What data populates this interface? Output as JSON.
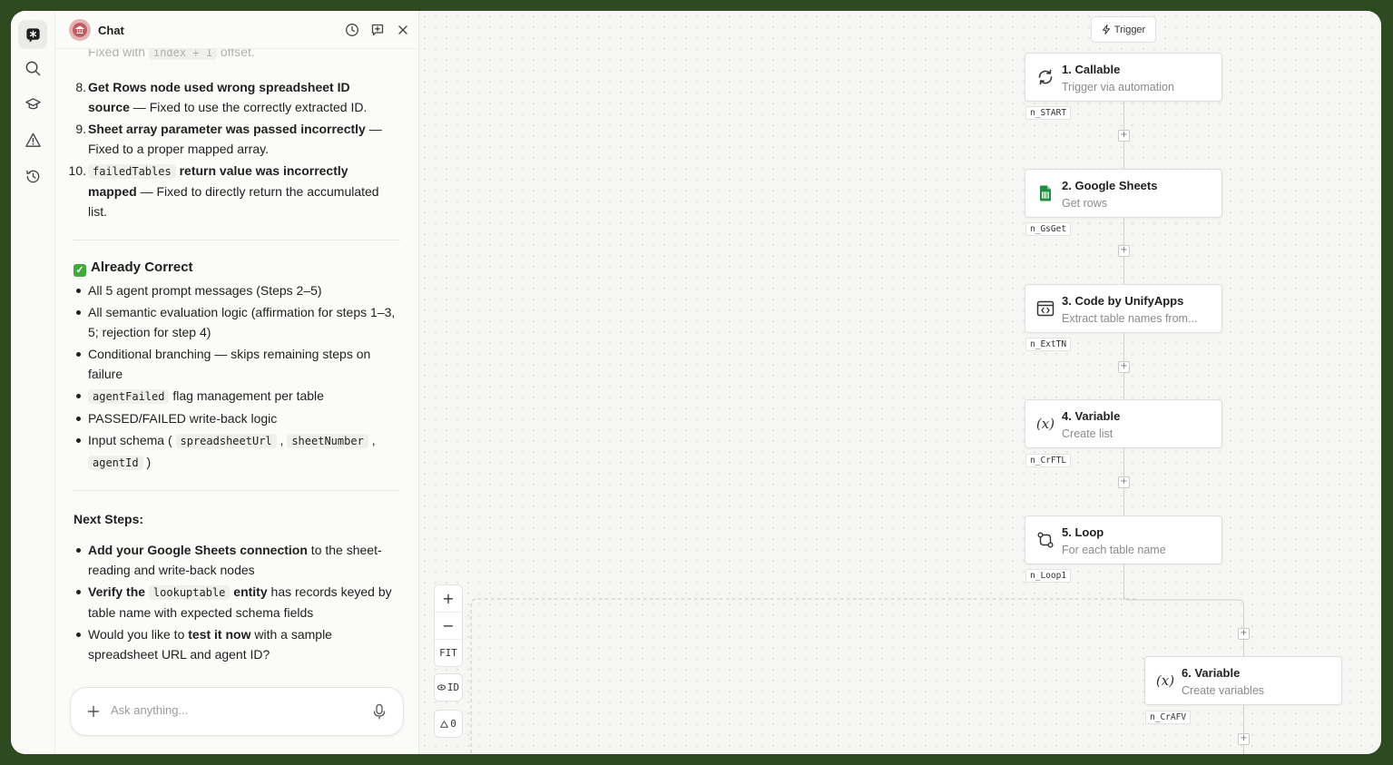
{
  "chat": {
    "title": "Chat",
    "faded_line": {
      "pre": "Fixed with ",
      "code": "index + 1",
      "post": " offset."
    },
    "fixes": [
      {
        "num": "8.",
        "bold": "Get Rows node used wrong spreadsheet ID",
        "bold2": "source",
        "rest": " — Fixed to use the correctly extracted ID."
      },
      {
        "num": "9.",
        "bold": "Sheet array parameter was passed incorrectly",
        "rest": " — Fixed to a proper mapped array."
      },
      {
        "num": "10.",
        "code": "failedTables",
        "bold": " return value was incorrectly",
        "bold2": "mapped",
        "rest": " — Fixed to directly return the accumulated list."
      }
    ],
    "correct_title": "Already Correct",
    "correct_items": [
      "All 5 agent prompt messages (Steps 2–5)",
      "All semantic evaluation logic (affirmation for steps 1–3, 5; rejection for step 4)",
      "Conditional branching — skips remaining steps on failure",
      "PASSED/FAILED write-back logic"
    ],
    "flag_item": {
      "code": "agentFailed",
      "text": " flag management per table"
    },
    "schema_item": {
      "pre": "Input schema ( ",
      "code1": "spreadsheetUrl",
      "sep1": " , ",
      "code2": "sheetNumber",
      "sep2": " ,",
      "code3": "agentId",
      "post": " )"
    },
    "next_title": "Next Steps:",
    "next_items": [
      {
        "bold": "Add your Google Sheets connection",
        "rest": " to the sheet-reading and write-back nodes"
      },
      {
        "bold": "Verify the ",
        "code": "lookuptable",
        "bold2": " entity",
        "rest": " has records keyed by table name with expected schema fields"
      },
      {
        "pre": "Would you like to ",
        "bold": "test it now",
        "rest": " with a sample spreadsheet URL and agent ID?"
      }
    ],
    "composer_placeholder": "Ask anything..."
  },
  "canvas": {
    "trigger_label": "Trigger",
    "nodes": [
      {
        "title": "1. Callable",
        "subtitle": "Trigger via automation",
        "id": "n_START",
        "icon": "refresh-icon"
      },
      {
        "title": "2. Google Sheets",
        "subtitle": "Get rows",
        "id": "n_GsGet",
        "icon": "google-sheets-icon"
      },
      {
        "title": "3. Code by UnifyApps",
        "subtitle": "Extract table names from...",
        "id": "n_ExtTN",
        "icon": "code-window-icon"
      },
      {
        "title": "4. Variable",
        "subtitle": "Create list",
        "id": "n_CrFTL",
        "icon": "variable-icon",
        "glyph": "(x)"
      },
      {
        "title": "5. Loop",
        "subtitle": "For each table name",
        "id": "n_Loop1",
        "icon": "loop-icon"
      },
      {
        "title": "6. Variable",
        "subtitle": "Create variables",
        "id": "n_CrAFV",
        "icon": "variable-icon",
        "glyph": "(x)"
      }
    ],
    "controls": {
      "zoom_in": "+",
      "zoom_out": "−",
      "fit": "FIT",
      "id_toggle": "ID",
      "warnings": "0"
    }
  },
  "colors": {
    "frame": "#2e4a20",
    "sheets_green": "#1e8e3e",
    "check_green": "#3faa3a"
  }
}
